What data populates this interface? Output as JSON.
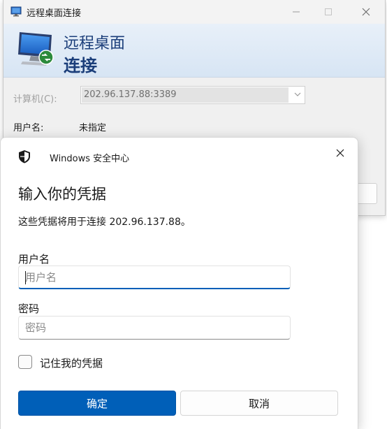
{
  "rdp_window": {
    "title": "远程桌面连接",
    "banner": {
      "line1": "远程桌面",
      "line2": "连接"
    },
    "computer_label": "计算机(C):",
    "computer_value": "202.96.137.88:3389",
    "username_label": "用户名:",
    "username_value": "未指定"
  },
  "credential_dialog": {
    "header_title": "Windows 安全中心",
    "heading": "输入你的凭据",
    "description": "这些凭据将用于连接 202.96.137.88。",
    "username": {
      "label": "用户名",
      "placeholder": "用户名",
      "value": ""
    },
    "password": {
      "label": "密码",
      "placeholder": "密码",
      "value": ""
    },
    "remember_label": "记住我的凭据",
    "remember_checked": false,
    "ok_label": "确定",
    "cancel_label": "取消"
  },
  "icons": {
    "app": "remote-desktop-icon",
    "logo": "remote-desktop-logo-icon",
    "shield": "shield-icon",
    "close": "close-icon",
    "chevron": "chevron-down-icon"
  },
  "colors": {
    "accent": "#005fb8",
    "banner_text": "#1b3e7a",
    "banner_bg": "#dce8f5"
  }
}
